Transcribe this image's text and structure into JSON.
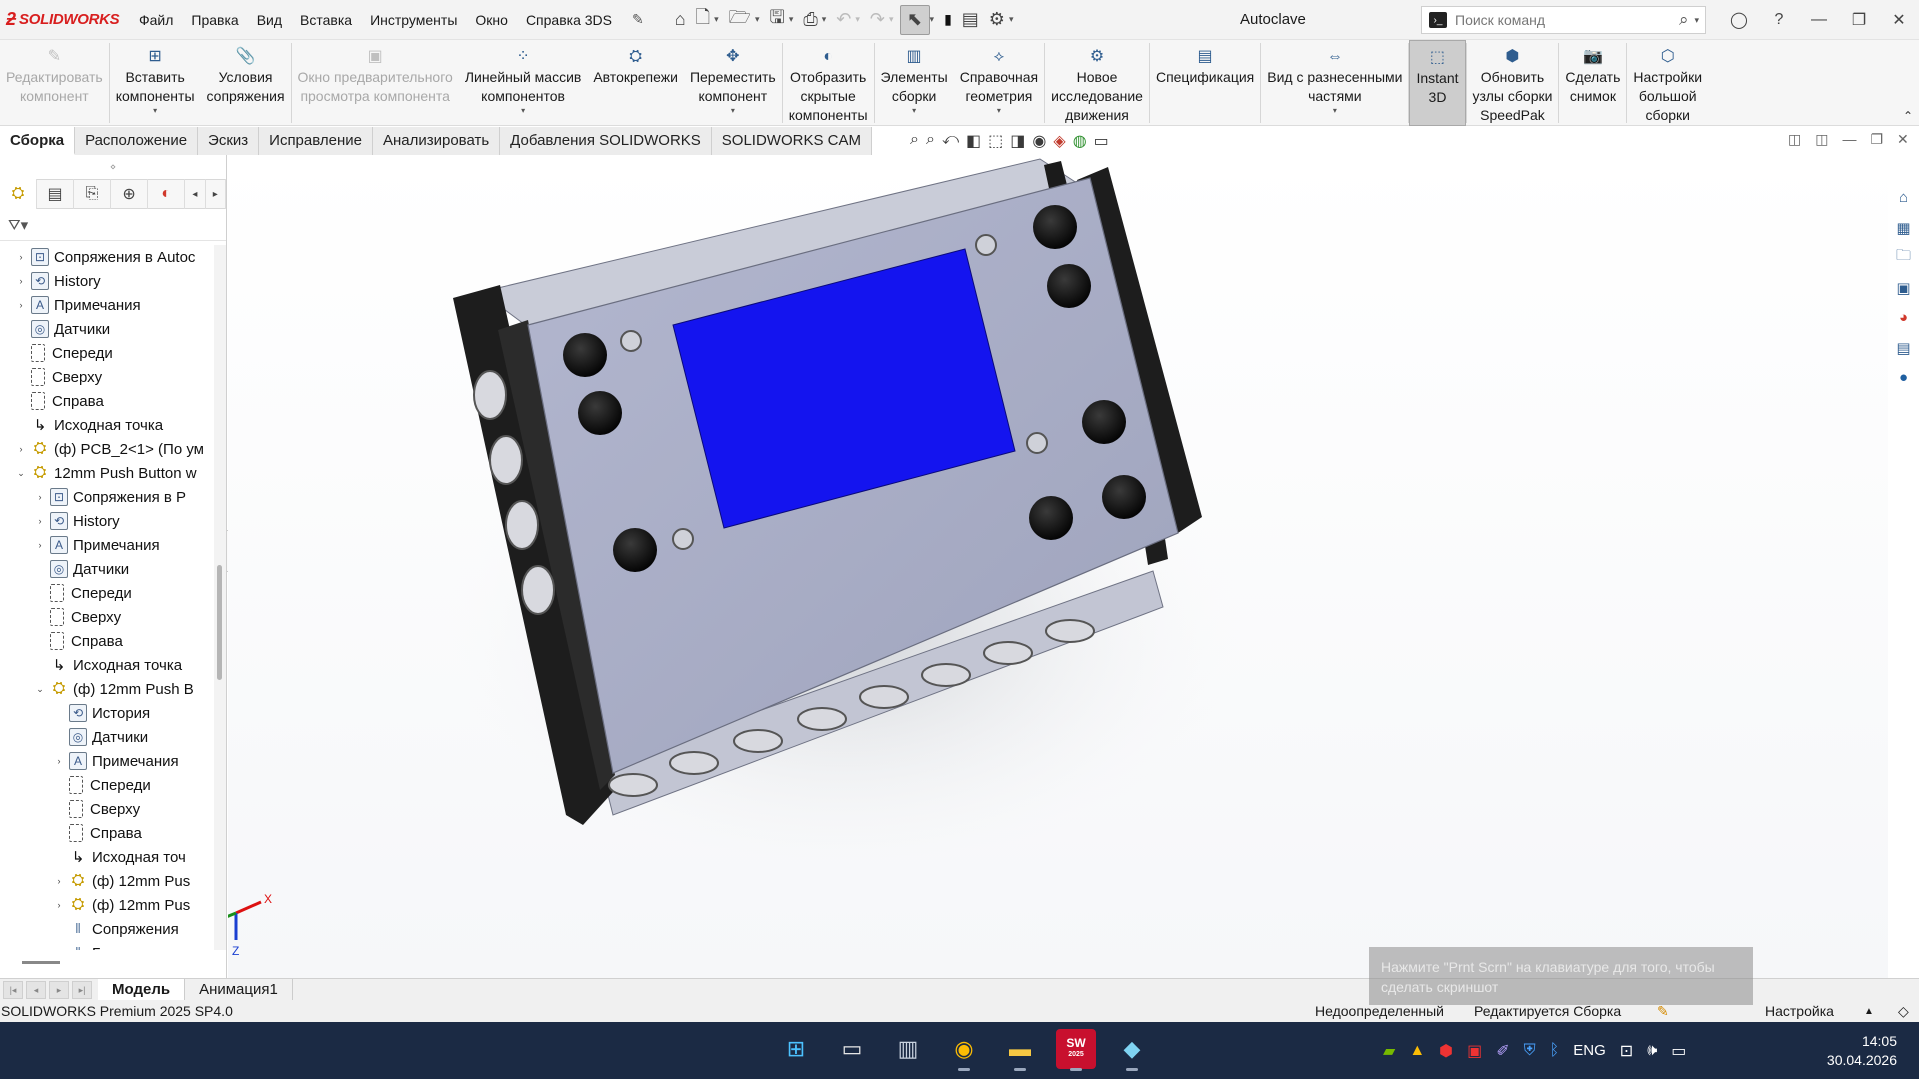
{
  "titlebar": {
    "logo_text": "SOLIDWORKS",
    "menu": [
      "Файл",
      "Правка",
      "Вид",
      "Вставка",
      "Инструменты",
      "Окно",
      "Справка 3DS"
    ],
    "doc_title": "Autoclave",
    "search_placeholder": "Поиск команд"
  },
  "ribbon": {
    "tools": [
      {
        "label1": "Редактировать",
        "label2": "компонент",
        "label3": "",
        "icon": "edit-component-icon",
        "disabled": true,
        "drop": false
      },
      {
        "label1": "Вставить",
        "label2": "компоненты",
        "label3": "",
        "icon": "insert-components-icon",
        "disabled": false,
        "drop": true
      },
      {
        "label1": "Условия",
        "label2": "сопряжения",
        "label3": "",
        "icon": "mate-icon",
        "disabled": false,
        "drop": false
      },
      {
        "label1": "Окно предварительного",
        "label2": "просмотра компонента",
        "label3": "",
        "icon": "preview-window-icon",
        "disabled": true,
        "drop": false
      },
      {
        "label1": "Линейный массив",
        "label2": "компонентов",
        "label3": "",
        "icon": "linear-pattern-icon",
        "disabled": false,
        "drop": true
      },
      {
        "label1": "Автокрепежи",
        "label2": "",
        "label3": "",
        "icon": "smart-fasteners-icon",
        "disabled": false,
        "drop": false
      },
      {
        "label1": "Переместить",
        "label2": "компонент",
        "label3": "",
        "icon": "move-component-icon",
        "disabled": false,
        "drop": true
      },
      {
        "label1": "Отобразить",
        "label2": "скрытые",
        "label3": "компоненты",
        "icon": "show-hidden-icon",
        "disabled": false,
        "drop": false
      },
      {
        "label1": "Элементы",
        "label2": "сборки",
        "label3": "",
        "icon": "assembly-features-icon",
        "disabled": false,
        "drop": true
      },
      {
        "label1": "Справочная",
        "label2": "геометрия",
        "label3": "",
        "icon": "reference-geometry-icon",
        "disabled": false,
        "drop": true
      },
      {
        "label1": "Новое",
        "label2": "исследование",
        "label3": "движения",
        "icon": "motion-study-icon",
        "disabled": false,
        "drop": false
      },
      {
        "label1": "Спецификация",
        "label2": "",
        "label3": "",
        "icon": "bom-icon",
        "disabled": false,
        "drop": false
      },
      {
        "label1": "Вид с разнесенными",
        "label2": "частями",
        "label3": "",
        "icon": "exploded-view-icon",
        "disabled": false,
        "drop": true
      },
      {
        "label1": "Instant",
        "label2": "3D",
        "label3": "",
        "icon": "instant3d-icon",
        "disabled": false,
        "drop": false,
        "active": true
      },
      {
        "label1": "Обновить",
        "label2": "узлы сборки",
        "label3": "SpeedPak",
        "icon": "speedpak-icon",
        "disabled": false,
        "drop": false
      },
      {
        "label1": "Сделать",
        "label2": "снимок",
        "label3": "",
        "icon": "snapshot-icon",
        "disabled": false,
        "drop": false
      },
      {
        "label1": "Настройки",
        "label2": "большой",
        "label3": "сборки",
        "icon": "large-assembly-icon",
        "disabled": false,
        "drop": false
      }
    ]
  },
  "tabs": [
    "Сборка",
    "Расположение",
    "Эскиз",
    "Исправление",
    "Анализировать",
    "Добавления SOLIDWORKS",
    "SOLIDWORKS CAM"
  ],
  "active_tab": "Сборка",
  "tree": [
    {
      "label": "Сопряжения в Autoc",
      "level": 1,
      "icon": "folder",
      "expand": "›"
    },
    {
      "label": "History",
      "level": 1,
      "icon": "history",
      "expand": "›"
    },
    {
      "label": "Примечания",
      "level": 1,
      "icon": "annot",
      "expand": "›"
    },
    {
      "label": "Датчики",
      "level": 1,
      "icon": "sensor",
      "expand": ""
    },
    {
      "label": "Спереди",
      "level": 1,
      "icon": "plane",
      "expand": ""
    },
    {
      "label": "Сверху",
      "level": 1,
      "icon": "plane",
      "expand": ""
    },
    {
      "label": "Справа",
      "level": 1,
      "icon": "plane",
      "expand": ""
    },
    {
      "label": "Исходная точка",
      "level": 1,
      "icon": "origin",
      "expand": ""
    },
    {
      "label": "(ф) PCB_2<1> (По ум",
      "level": 1,
      "icon": "asm",
      "expand": "›"
    },
    {
      "label": "12mm Push Button w",
      "level": 1,
      "icon": "asm",
      "expand": "⌄"
    },
    {
      "label": "Сопряжения в Р",
      "level": 2,
      "icon": "folder",
      "expand": "›"
    },
    {
      "label": "History",
      "level": 2,
      "icon": "history",
      "expand": "›"
    },
    {
      "label": "Примечания",
      "level": 2,
      "icon": "annot",
      "expand": "›"
    },
    {
      "label": "Датчики",
      "level": 2,
      "icon": "sensor",
      "expand": ""
    },
    {
      "label": "Спереди",
      "level": 2,
      "icon": "plane",
      "expand": ""
    },
    {
      "label": "Сверху",
      "level": 2,
      "icon": "plane",
      "expand": ""
    },
    {
      "label": "Справа",
      "level": 2,
      "icon": "plane",
      "expand": ""
    },
    {
      "label": "Исходная точка",
      "level": 2,
      "icon": "origin",
      "expand": ""
    },
    {
      "label": "(ф) 12mm Push B",
      "level": 2,
      "icon": "asm",
      "expand": "⌄"
    },
    {
      "label": "История",
      "level": 3,
      "icon": "history",
      "expand": ""
    },
    {
      "label": "Датчики",
      "level": 3,
      "icon": "sensor",
      "expand": ""
    },
    {
      "label": "Примечания",
      "level": 3,
      "icon": "annot",
      "expand": "›"
    },
    {
      "label": "Спереди",
      "level": 3,
      "icon": "plane",
      "expand": ""
    },
    {
      "label": "Сверху",
      "level": 3,
      "icon": "plane",
      "expand": ""
    },
    {
      "label": "Справа",
      "level": 3,
      "icon": "plane",
      "expand": ""
    },
    {
      "label": "Исходная точ",
      "level": 3,
      "icon": "origin",
      "expand": ""
    },
    {
      "label": "(ф) 12mm Pus",
      "level": 3,
      "icon": "asm",
      "expand": "›"
    },
    {
      "label": "(ф) 12mm Pus",
      "level": 3,
      "icon": "asm",
      "expand": "›"
    },
    {
      "label": "Сопряжения",
      "level": 3,
      "icon": "mate",
      "expand": ""
    },
    {
      "label": "Группа сопряже",
      "level": 3,
      "icon": "mate",
      "expand": ""
    }
  ],
  "bottom_tabs": [
    "Модель",
    "Анимация1"
  ],
  "active_bottom_tab": "Модель",
  "status": {
    "product": "SOLIDWORKS Premium 2025 SP4.0",
    "definition": "Недоопределенный",
    "editing": "Редактируется Сборка",
    "units": "Настройка"
  },
  "toast": {
    "line1": "Нажмите \"Prnt Scrn\" на клавиатуре для того, чтобы",
    "line2": "сделать скриншот"
  },
  "triad": {
    "x": "X",
    "z": "Z"
  },
  "taskbar": {
    "lang": "ENG",
    "time": "14:05",
    "date": "30.04.2026",
    "sw_badge": "SW",
    "sw_year": "2025"
  },
  "colors": {
    "brand": "#d81e1e",
    "screen_blue": "#1414ef",
    "taskbar": "#1b2a44",
    "enclosure": "#a6abc4"
  }
}
